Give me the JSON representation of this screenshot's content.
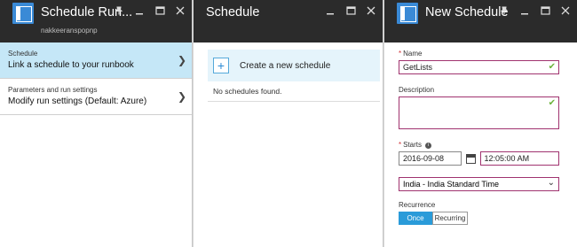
{
  "blade1": {
    "title": "Schedule Run...",
    "subtitle": "nakkeeranspopnp",
    "items": [
      {
        "small": "Schedule",
        "big": "Link a schedule to your runbook"
      },
      {
        "small": "Parameters and run settings",
        "big": "Modify run settings (Default: Azure)"
      }
    ]
  },
  "blade2": {
    "title": "Schedule",
    "create_label": "Create a new schedule",
    "empty_text": "No schedules found."
  },
  "blade3": {
    "title": "New Schedule",
    "name_label": "Name",
    "name_value": "GetLists",
    "description_label": "Description",
    "starts_label": "Starts",
    "start_date": "2016-09-08",
    "start_time": "12:05:00 AM",
    "timezone": "India - India Standard Time",
    "recurrence_label": "Recurrence",
    "recurrence_options": [
      "Once",
      "Recurring"
    ],
    "recurrence_selected": "Once"
  },
  "icons": {
    "pin": "pin-icon",
    "minimize": "minimize-icon",
    "maximize": "maximize-icon",
    "close": "close-icon"
  },
  "colors": {
    "header_bg": "#2b2b2b",
    "active_item": "#c5e7f7",
    "accent": "#2a9bd9",
    "field_border": "#a0336f",
    "valid_check": "#6bb33a"
  }
}
